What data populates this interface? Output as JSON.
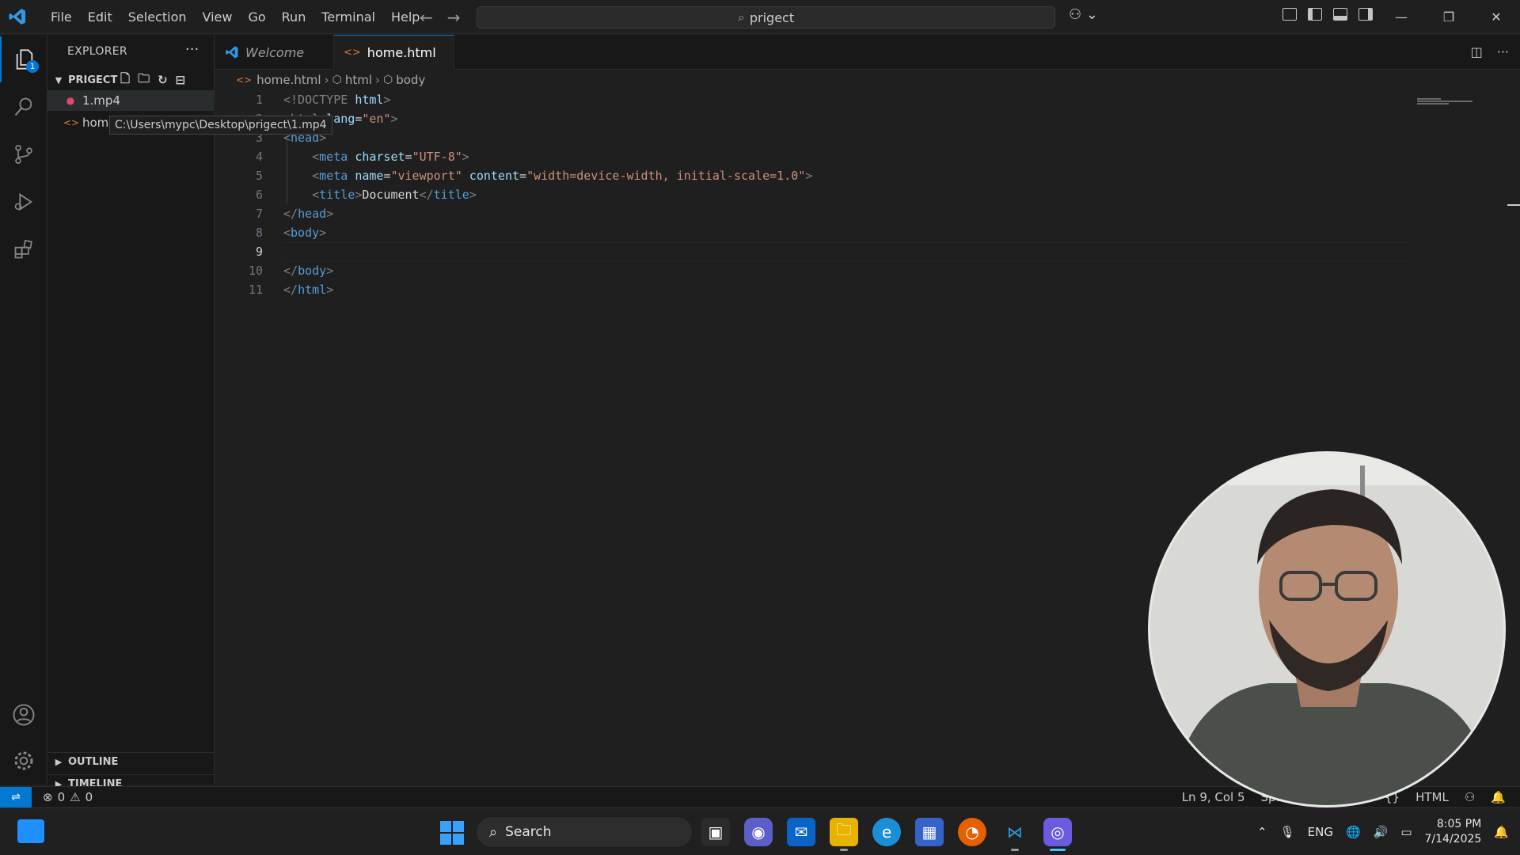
{
  "titlebar": {
    "menu": [
      "File",
      "Edit",
      "Selection",
      "View",
      "Go",
      "Run",
      "Terminal",
      "Help"
    ],
    "search_text": "prigect"
  },
  "activity": {
    "explorer_badge": "1"
  },
  "sidebar": {
    "title": "EXPLORER",
    "project_name": "PRIGECT",
    "files": [
      {
        "name": "1.mp4"
      },
      {
        "name": "hom"
      }
    ],
    "tooltip": "C:\\Users\\mypc\\Desktop\\prigect\\1.mp4",
    "outline_label": "OUTLINE",
    "timeline_label": "TIMELINE"
  },
  "tabs": [
    {
      "label": "Welcome",
      "active": false
    },
    {
      "label": "home.html",
      "active": true,
      "dirty": true
    }
  ],
  "breadcrumb": [
    "home.html",
    "html",
    "body"
  ],
  "editor": {
    "line_numbers": [
      "1",
      "2",
      "3",
      "4",
      "5",
      "6",
      "7",
      "8",
      "9",
      "10",
      "11"
    ],
    "current_line": "9",
    "code": {
      "l1_doctype": "<!DOCTYPE ",
      "l1_html": "html",
      "l1_close": ">",
      "l2_open": "<html ",
      "l2_attr": "lang",
      "l2_eq": "=",
      "l2_val": "\"en\"",
      "l2_close": ">",
      "l3_open": "<",
      "l3_tag": "head",
      "l3_close": ">",
      "l4_open": "<",
      "l4_tag": "meta ",
      "l4_attr": "charset",
      "l4_eq": "=",
      "l4_val": "\"UTF-8\"",
      "l4_close": ">",
      "l5_open": "<",
      "l5_tag": "meta ",
      "l5_attr1": "name",
      "l5_eq1": "=",
      "l5_val1": "\"viewport\"",
      "l5_attr2": " content",
      "l5_eq2": "=",
      "l5_val2": "\"width=device-width, initial-scale=1.0\"",
      "l5_close": ">",
      "l6_open": "<",
      "l6_tag": "title",
      "l6_close": ">",
      "l6_text": "Document",
      "l6_end_open": "</",
      "l6_end_tag": "title",
      "l6_end_close": ">",
      "l7_open": "</",
      "l7_tag": "head",
      "l7_close": ">",
      "l8_open": "<",
      "l8_tag": "body",
      "l8_close": ">",
      "l10_open": "</",
      "l10_tag": "body",
      "l10_close": ">",
      "l11_open": "</",
      "l11_tag": "html",
      "l11_close": ">"
    }
  },
  "statusbar": {
    "errors": "0",
    "warnings": "0",
    "position": "Ln 9, Col 5",
    "spaces": "Spac",
    "language": "HTML"
  },
  "taskbar": {
    "search_label": "Search",
    "language": "ENG",
    "time": "8:05 PM",
    "date": "7/14/2025"
  },
  "colors": {
    "accent": "#0078d4",
    "background": "#1f1f1f",
    "sidebar": "#181818"
  }
}
